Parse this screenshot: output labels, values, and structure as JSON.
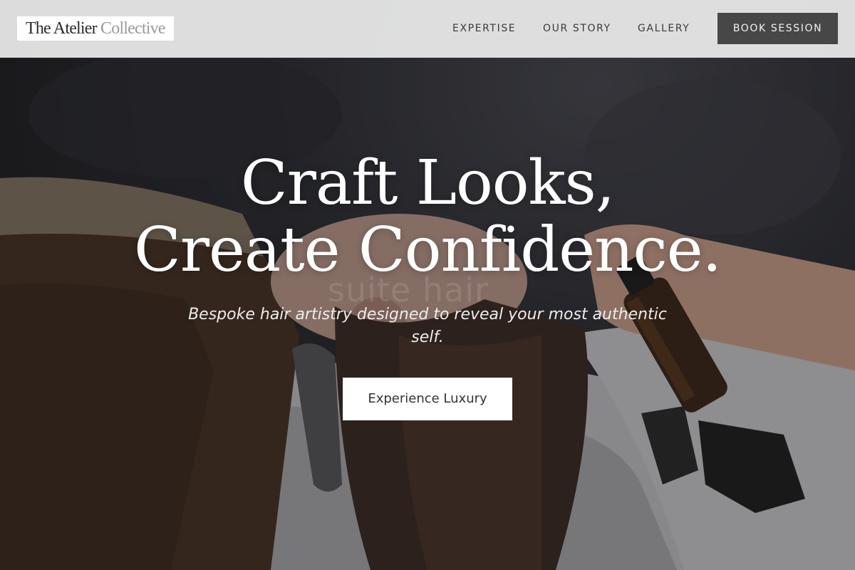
{
  "brand": {
    "name_primary": "The Atelier",
    "name_secondary": "Collective"
  },
  "nav": {
    "links": [
      {
        "label": "EXPERTISE"
      },
      {
        "label": "OUR STORY"
      },
      {
        "label": "GALLERY"
      }
    ],
    "cta_label": "BOOK SESSION"
  },
  "hero": {
    "headline_line1": "Craft Looks,",
    "headline_line2": "Create Confidence.",
    "subtitle": "Bespoke hair artistry designed to reveal your most authentic self.",
    "button_label": "Experience Luxury",
    "photo_watermark": "suite hair"
  },
  "colors": {
    "header_bg": "#ececec",
    "cta_bg": "#474747",
    "text_light": "#ffffff"
  }
}
